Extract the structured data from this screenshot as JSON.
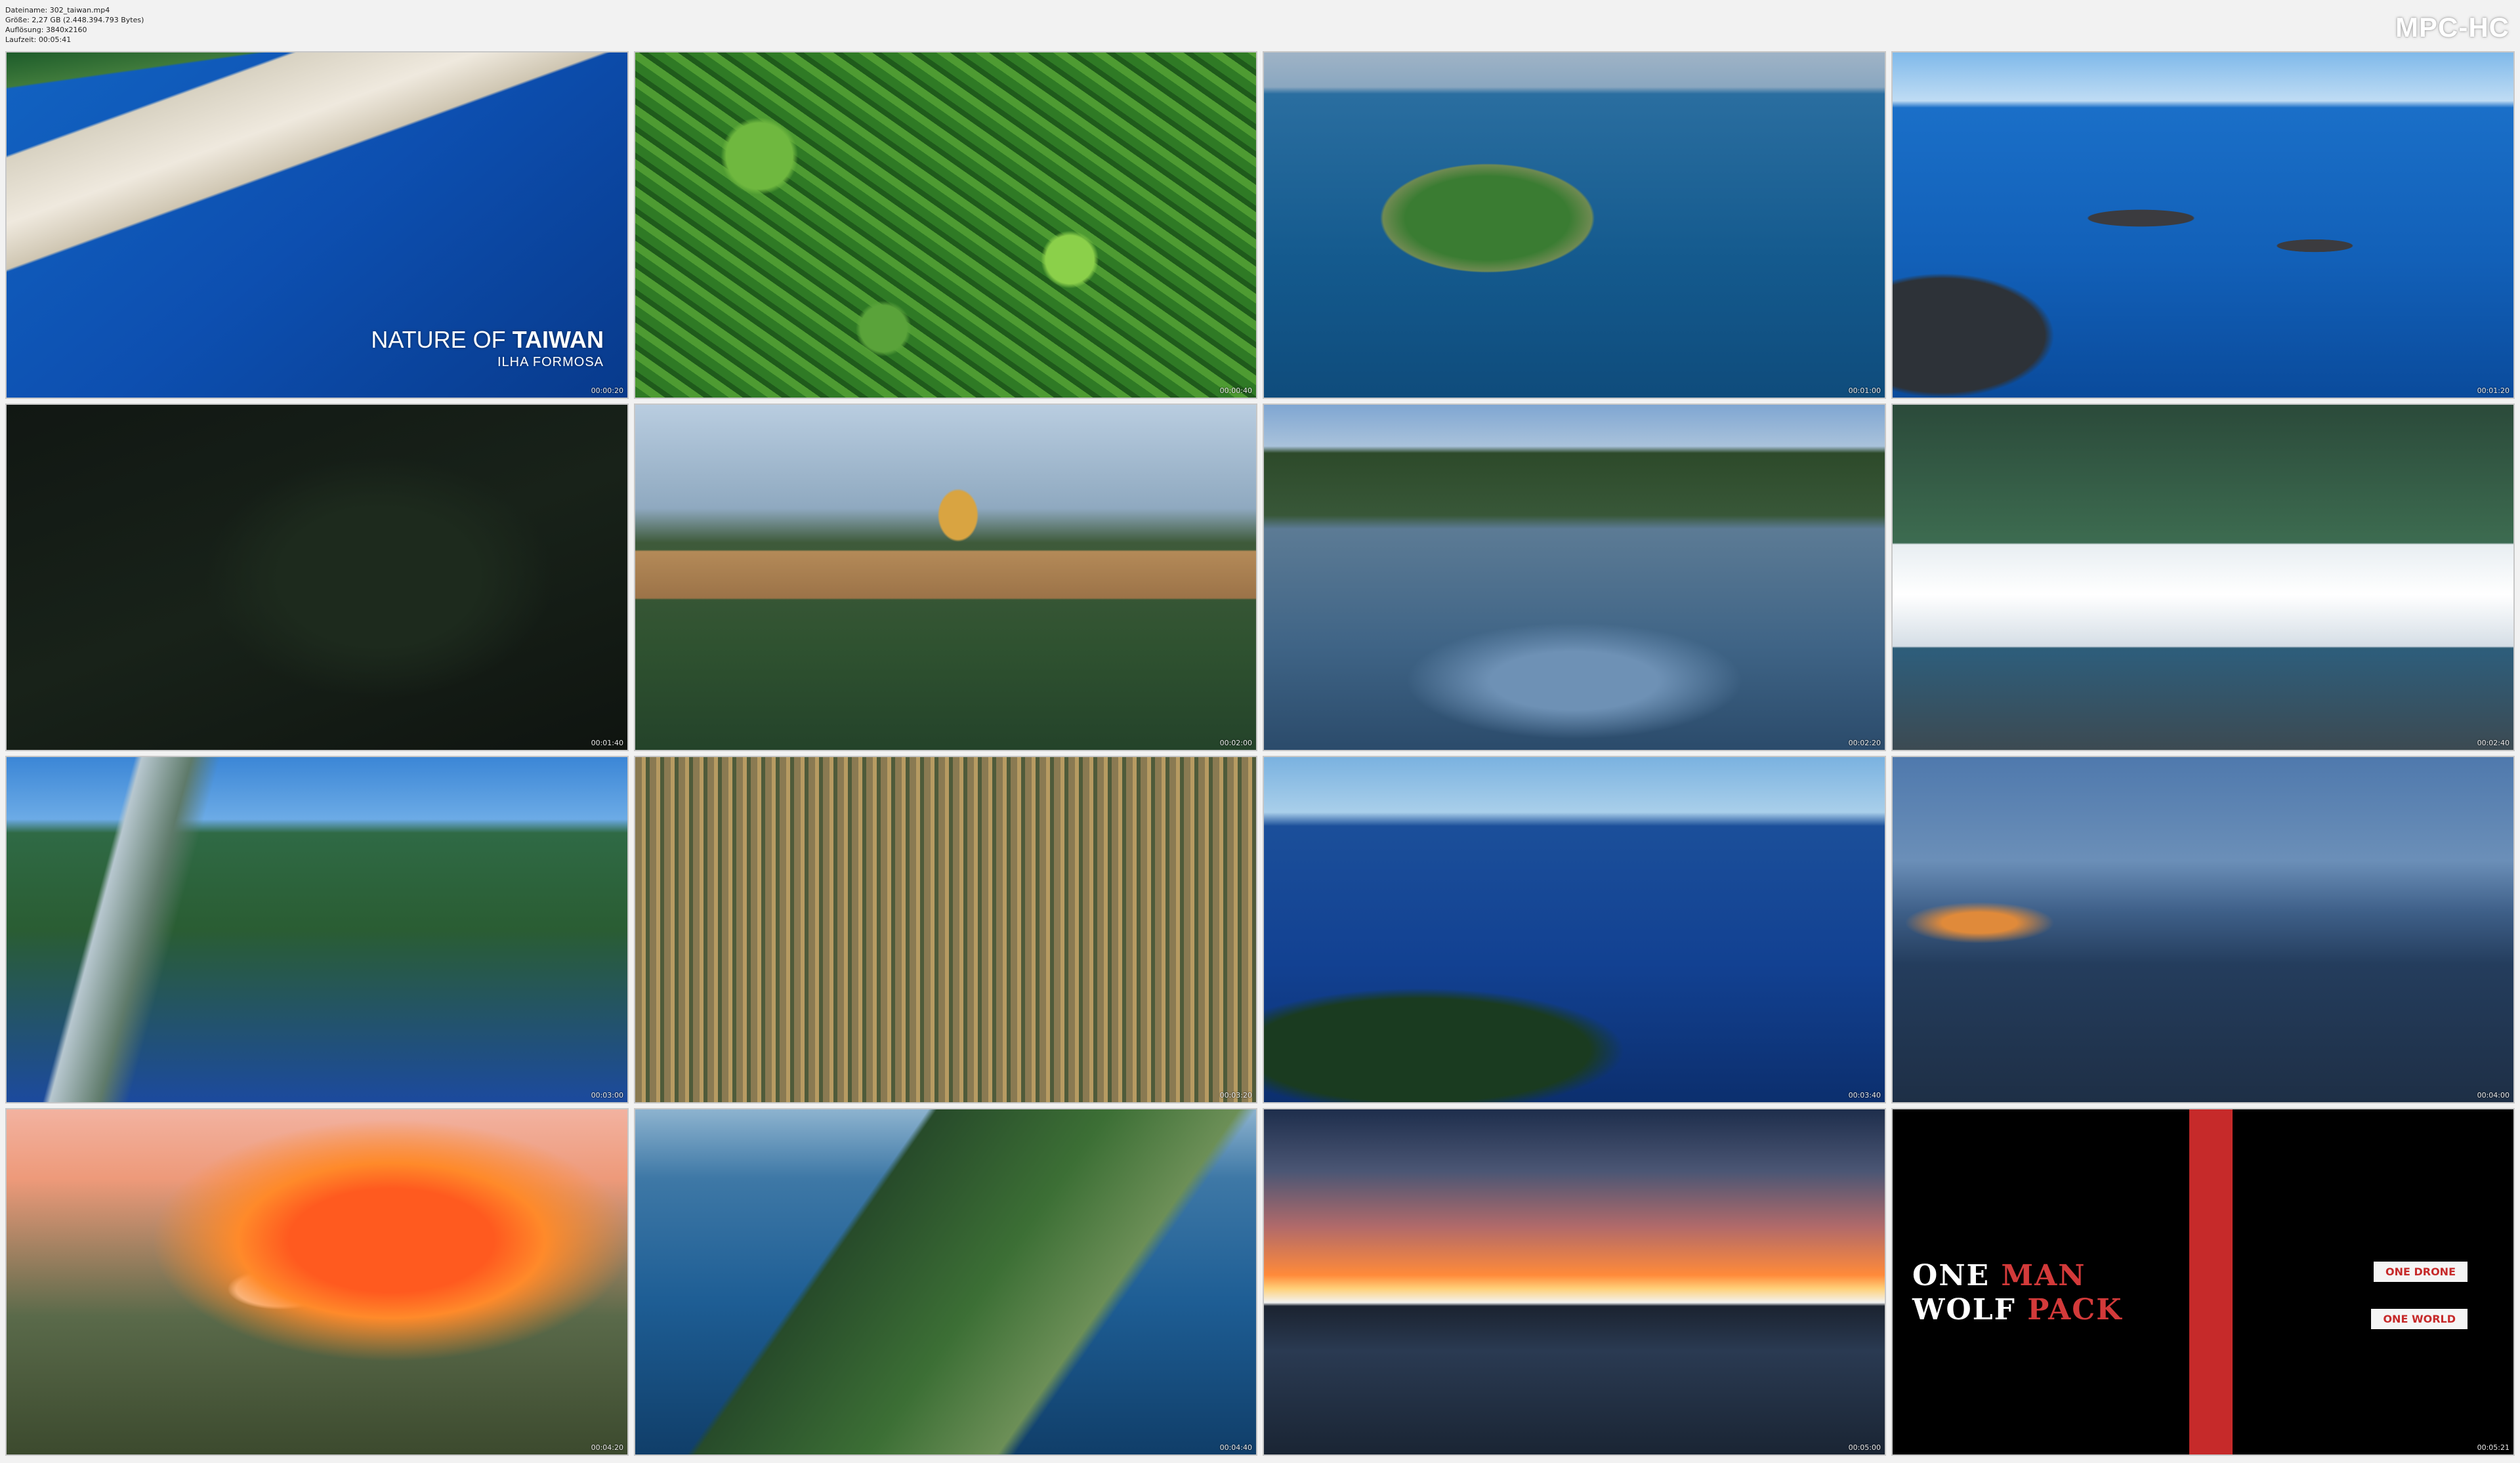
{
  "meta": {
    "filename": "Dateiname: 302_taiwan.mp4",
    "size": "Größe: 2,27 GB (2.448.394.793 Bytes)",
    "resolution": "Auflösung: 3840x2160",
    "duration": "Laufzeit: 00:05:41"
  },
  "logo": "MPC-HC",
  "video_title": {
    "line1_prefix": "NATURE OF",
    "line1_bold": "TAIWAN",
    "line2": "ILHA FORMOSA"
  },
  "end_card": {
    "om_line1a": "ONE",
    "om_line1b": "MAN",
    "om_line2a": "WOLF",
    "om_line2b": "PACK",
    "tag1": "ONE DRONE",
    "tag2": "ONE WORLD"
  },
  "thumbnails": [
    {
      "time": "00:00:20",
      "scene": "coastal-town"
    },
    {
      "time": "00:00:40",
      "scene": "forest-canopy"
    },
    {
      "time": "00:01:00",
      "scene": "island"
    },
    {
      "time": "00:01:20",
      "scene": "rocky-sea"
    },
    {
      "time": "00:01:40",
      "scene": "dark-forest"
    },
    {
      "time": "00:02:00",
      "scene": "temple-hill"
    },
    {
      "time": "00:02:20",
      "scene": "lake-boat"
    },
    {
      "time": "00:02:40",
      "scene": "white-palace"
    },
    {
      "time": "00:03:00",
      "scene": "coastline"
    },
    {
      "time": "00:03:20",
      "scene": "tree-rows"
    },
    {
      "time": "00:03:40",
      "scene": "cliff-ocean"
    },
    {
      "time": "00:04:00",
      "scene": "sunset-bay"
    },
    {
      "time": "00:04:20",
      "scene": "red-haze-temple"
    },
    {
      "time": "00:04:40",
      "scene": "cape-coast"
    },
    {
      "time": "00:05:00",
      "scene": "sunset-river"
    },
    {
      "time": "00:05:21",
      "scene": "end-card"
    }
  ]
}
